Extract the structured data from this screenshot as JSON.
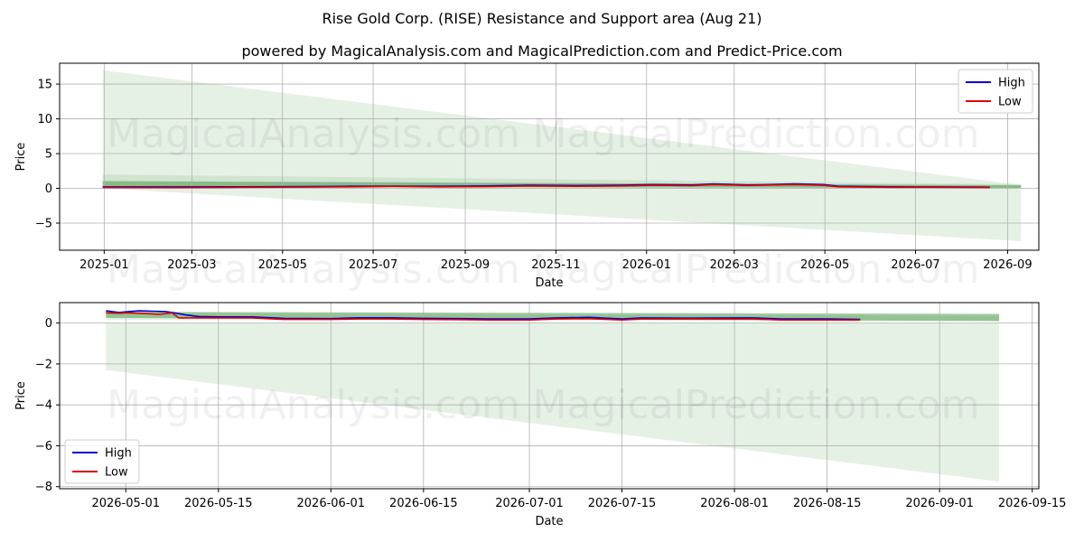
{
  "figure": {
    "title": "Rise Gold Corp. (RISE) Resistance and Support area (Aug 21)",
    "subtitle": "powered by MagicalAnalysis.com and MagicalPrediction.com and Predict-Price.com",
    "watermark_left": "MagicalAnalysis.com",
    "watermark_right": "MagicalPrediction.com"
  },
  "chart_data": [
    {
      "type": "line",
      "xlabel": "Date",
      "ylabel": "Price",
      "x_range": [
        "2024-12-02",
        "2026-09-22"
      ],
      "ylim": [
        -8.9,
        18.0
      ],
      "x_ticks": [
        "2025-01",
        "2025-03",
        "2025-05",
        "2025-07",
        "2025-09",
        "2025-11",
        "2026-01",
        "2026-03",
        "2026-05",
        "2026-07",
        "2026-09"
      ],
      "y_ticks": [
        15,
        10,
        5,
        0,
        -5
      ],
      "grid": true,
      "legend_position": "top-right",
      "series": [
        {
          "name": "High",
          "color": "#0000cc",
          "points": [
            [
              "2024-12-31",
              0.2
            ],
            [
              "2025-02-15",
              0.2
            ],
            [
              "2025-04-01",
              0.22
            ],
            [
              "2025-05-15",
              0.25
            ],
            [
              "2025-06-15",
              0.3
            ],
            [
              "2025-07-15",
              0.32
            ],
            [
              "2025-08-15",
              0.3
            ],
            [
              "2025-09-15",
              0.35
            ],
            [
              "2025-10-15",
              0.45
            ],
            [
              "2025-11-15",
              0.4
            ],
            [
              "2025-12-15",
              0.45
            ],
            [
              "2026-01-05",
              0.55
            ],
            [
              "2026-02-01",
              0.5
            ],
            [
              "2026-02-15",
              0.65
            ],
            [
              "2026-03-10",
              0.5
            ],
            [
              "2026-03-25",
              0.55
            ],
            [
              "2026-04-10",
              0.65
            ],
            [
              "2026-04-30",
              0.55
            ],
            [
              "2026-05-10",
              0.3
            ],
            [
              "2026-06-15",
              0.22
            ],
            [
              "2026-07-15",
              0.2
            ],
            [
              "2026-08-20",
              0.17
            ]
          ]
        },
        {
          "name": "Low",
          "color": "#dd0000",
          "points": [
            [
              "2024-12-31",
              0.12
            ],
            [
              "2025-02-15",
              0.1
            ],
            [
              "2025-04-01",
              0.15
            ],
            [
              "2025-05-15",
              0.18
            ],
            [
              "2025-06-15",
              0.22
            ],
            [
              "2025-07-15",
              0.28
            ],
            [
              "2025-08-15",
              0.22
            ],
            [
              "2025-09-15",
              0.25
            ],
            [
              "2025-10-15",
              0.35
            ],
            [
              "2025-11-15",
              0.3
            ],
            [
              "2025-12-15",
              0.35
            ],
            [
              "2026-01-05",
              0.45
            ],
            [
              "2026-02-01",
              0.4
            ],
            [
              "2026-02-15",
              0.55
            ],
            [
              "2026-03-10",
              0.42
            ],
            [
              "2026-03-25",
              0.48
            ],
            [
              "2026-04-10",
              0.55
            ],
            [
              "2026-04-30",
              0.45
            ],
            [
              "2026-05-10",
              0.22
            ],
            [
              "2026-06-15",
              0.15
            ],
            [
              "2026-07-15",
              0.15
            ],
            [
              "2026-08-20",
              0.12
            ]
          ]
        }
      ],
      "resistance_band": {
        "color": "#2e8b2e",
        "upper": [
          [
            "2024-12-31",
            1.05
          ],
          [
            "2026-09-10",
            0.45
          ]
        ],
        "lower": [
          [
            "2024-12-31",
            0.3
          ],
          [
            "2026-09-10",
            0.05
          ]
        ]
      },
      "support_band": {
        "color": "#2e8b2e",
        "upper": [
          [
            "2024-12-31",
            2.0
          ],
          [
            "2026-09-10",
            0.6
          ]
        ],
        "lower": [
          [
            "2024-12-31",
            0.0
          ],
          [
            "2026-09-10",
            0.0
          ]
        ]
      },
      "prediction_cone": {
        "color": "#2e8b2e",
        "upper": [
          [
            "2024-12-31",
            17.0
          ],
          [
            "2026-09-10",
            0.5
          ]
        ],
        "lower": [
          [
            "2024-12-31",
            0.0
          ],
          [
            "2026-09-10",
            -7.6
          ]
        ]
      }
    },
    {
      "type": "line",
      "xlabel": "Date",
      "ylabel": "Price",
      "x_range": [
        "2026-04-21",
        "2026-09-16"
      ],
      "ylim": [
        -8.1,
        1.0
      ],
      "x_ticks": [
        "2026-05-01",
        "2026-05-15",
        "2026-06-01",
        "2026-06-15",
        "2026-07-01",
        "2026-07-15",
        "2026-08-01",
        "2026-08-15",
        "2026-09-01",
        "2026-09-15"
      ],
      "y_ticks": [
        0,
        -2,
        -4,
        -6,
        -8
      ],
      "grid": true,
      "legend_position": "bottom-left",
      "series": [
        {
          "name": "High",
          "color": "#0000cc",
          "points": [
            [
              "2026-04-28",
              0.6
            ],
            [
              "2026-04-30",
              0.52
            ],
            [
              "2026-05-01",
              0.55
            ],
            [
              "2026-05-03",
              0.6
            ],
            [
              "2026-05-05",
              0.58
            ],
            [
              "2026-05-07",
              0.56
            ],
            [
              "2026-05-08",
              0.52
            ],
            [
              "2026-05-10",
              0.4
            ],
            [
              "2026-05-12",
              0.32
            ],
            [
              "2026-05-15",
              0.3
            ],
            [
              "2026-05-20",
              0.3
            ],
            [
              "2026-05-25",
              0.23
            ],
            [
              "2026-06-01",
              0.22
            ],
            [
              "2026-06-05",
              0.26
            ],
            [
              "2026-06-10",
              0.26
            ],
            [
              "2026-06-15",
              0.23
            ],
            [
              "2026-06-20",
              0.22
            ],
            [
              "2026-06-25",
              0.2
            ],
            [
              "2026-07-01",
              0.2
            ],
            [
              "2026-07-05",
              0.25
            ],
            [
              "2026-07-10",
              0.28
            ],
            [
              "2026-07-15",
              0.2
            ],
            [
              "2026-07-18",
              0.25
            ],
            [
              "2026-07-25",
              0.24
            ],
            [
              "2026-08-01",
              0.25
            ],
            [
              "2026-08-04",
              0.25
            ],
            [
              "2026-08-08",
              0.2
            ],
            [
              "2026-08-12",
              0.2
            ],
            [
              "2026-08-15",
              0.2
            ],
            [
              "2026-08-20",
              0.18
            ]
          ]
        },
        {
          "name": "Low",
          "color": "#dd0000",
          "points": [
            [
              "2026-04-28",
              0.5
            ],
            [
              "2026-04-30",
              0.48
            ],
            [
              "2026-05-01",
              0.5
            ],
            [
              "2026-05-03",
              0.48
            ],
            [
              "2026-05-05",
              0.45
            ],
            [
              "2026-05-06",
              0.42
            ],
            [
              "2026-05-08",
              0.5
            ],
            [
              "2026-05-09",
              0.25
            ],
            [
              "2026-05-12",
              0.25
            ],
            [
              "2026-05-15",
              0.25
            ],
            [
              "2026-05-20",
              0.25
            ],
            [
              "2026-05-25",
              0.18
            ],
            [
              "2026-06-01",
              0.18
            ],
            [
              "2026-06-05",
              0.2
            ],
            [
              "2026-06-10",
              0.2
            ],
            [
              "2026-06-15",
              0.18
            ],
            [
              "2026-06-20",
              0.17
            ],
            [
              "2026-06-25",
              0.15
            ],
            [
              "2026-07-01",
              0.15
            ],
            [
              "2026-07-05",
              0.2
            ],
            [
              "2026-07-10",
              0.22
            ],
            [
              "2026-07-15",
              0.15
            ],
            [
              "2026-07-18",
              0.2
            ],
            [
              "2026-07-25",
              0.2
            ],
            [
              "2026-08-01",
              0.2
            ],
            [
              "2026-08-04",
              0.2
            ],
            [
              "2026-08-08",
              0.15
            ],
            [
              "2026-08-12",
              0.15
            ],
            [
              "2026-08-15",
              0.15
            ],
            [
              "2026-08-20",
              0.15
            ]
          ]
        }
      ],
      "resistance_band": {
        "color": "#2e8b2e",
        "upper": [
          [
            "2026-04-28",
            0.55
          ],
          [
            "2026-09-10",
            0.45
          ]
        ],
        "lower": [
          [
            "2026-04-28",
            0.25
          ],
          [
            "2026-09-10",
            0.1
          ]
        ]
      },
      "support_band": {
        "color": "#2e8b2e",
        "upper": [
          [
            "2026-04-28",
            0.5
          ],
          [
            "2026-09-10",
            0.35
          ]
        ],
        "lower": [
          [
            "2026-04-28",
            0.15
          ],
          [
            "2026-09-10",
            0.1
          ]
        ]
      },
      "prediction_cone": {
        "color": "#2e8b2e",
        "upper": [
          [
            "2026-04-28",
            0.0
          ],
          [
            "2026-09-10",
            0.0
          ]
        ],
        "lower": [
          [
            "2026-04-28",
            -2.3
          ],
          [
            "2026-09-10",
            -7.75
          ]
        ]
      }
    }
  ]
}
